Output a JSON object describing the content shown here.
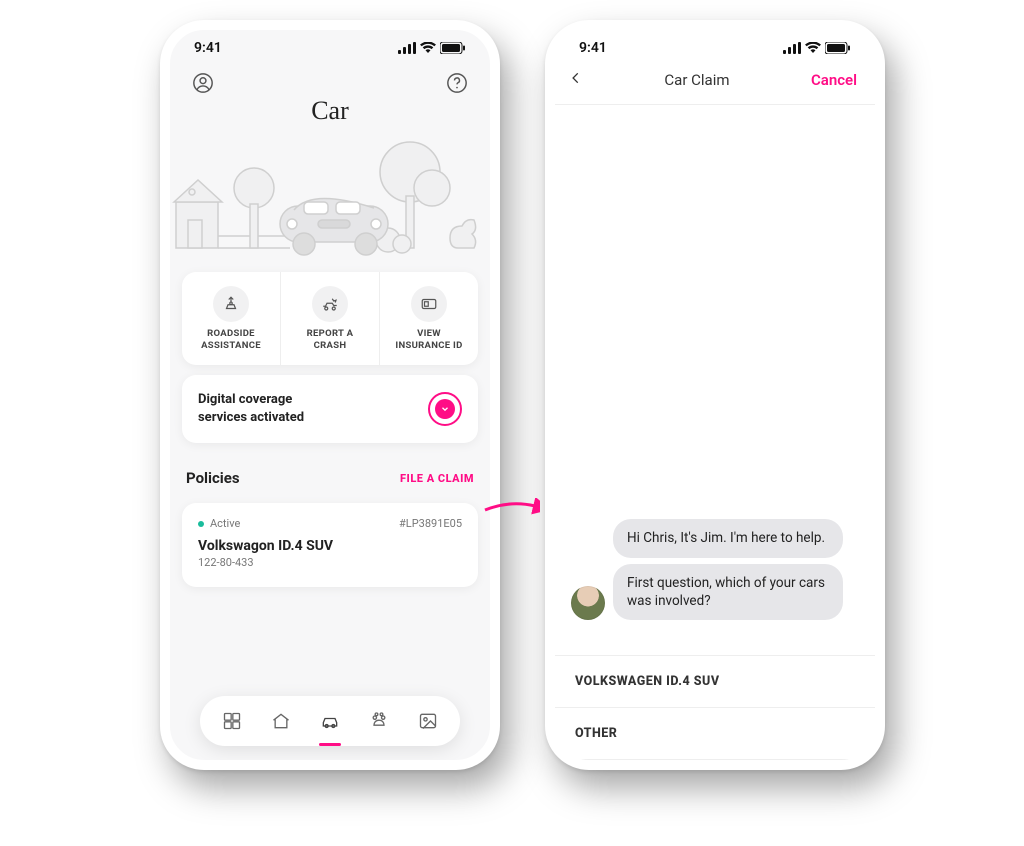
{
  "status": {
    "time": "9:41"
  },
  "phone1": {
    "title": "Car",
    "actions": [
      {
        "label_l1": "ROADSIDE",
        "label_l2": "ASSISTANCE"
      },
      {
        "label_l1": "REPORT A",
        "label_l2": "CRASH"
      },
      {
        "label_l1": "VIEW",
        "label_l2": "INSURANCE ID"
      }
    ],
    "coverage_l1": "Digital coverage",
    "coverage_l2": "services activated",
    "policies_heading": "Policies",
    "file_claim_label": "FILE A CLAIM",
    "policy": {
      "status": "Active",
      "number": "#LP3891E05",
      "name": "Volkswagon ID.4 SUV",
      "sub": "122-80-433"
    }
  },
  "phone2": {
    "title": "Car Claim",
    "cancel_label": "Cancel",
    "messages": [
      "Hi Chris, It's Jim. I'm here to help.",
      "First question, which of your cars was involved?"
    ],
    "options": [
      "VOLKSWAGEN ID.4 SUV",
      "OTHER"
    ]
  },
  "colors": {
    "accent": "#ff0d86"
  }
}
